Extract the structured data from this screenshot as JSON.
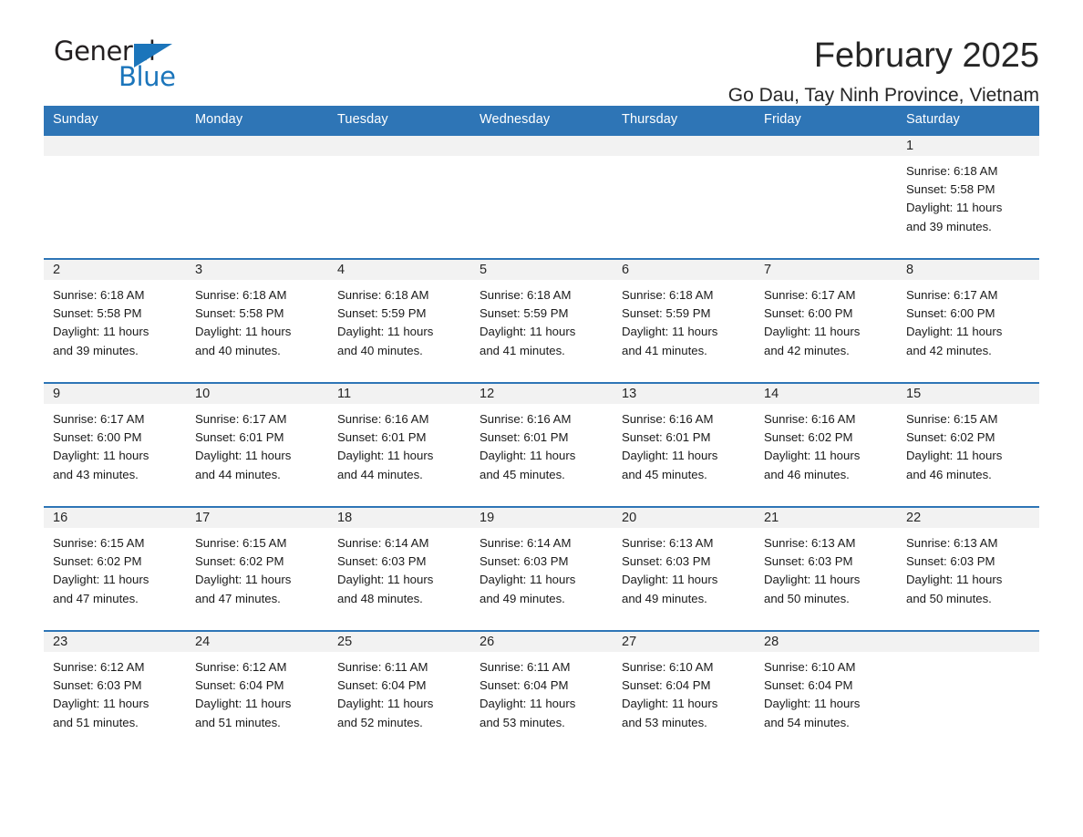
{
  "brand": {
    "name_top": "General",
    "name_bottom": "Blue",
    "accent_color": "#1b75bb",
    "triangle_icon": "brand-triangle-icon"
  },
  "header": {
    "title": "February 2025",
    "subtitle": "Go Dau, Tay Ninh Province, Vietnam"
  },
  "calendar": {
    "header_bg": "#2e75b6",
    "row_rule_color": "#2e75b6",
    "daynum_bg": "#f2f2f2",
    "weekday_headers": [
      "Sunday",
      "Monday",
      "Tuesday",
      "Wednesday",
      "Thursday",
      "Friday",
      "Saturday"
    ],
    "labels": {
      "sunrise": "Sunrise:",
      "sunset": "Sunset:",
      "daylight": "Daylight:"
    },
    "weeks": [
      [
        {
          "day": "",
          "sunrise": "",
          "sunset": "",
          "daylight": "",
          "daylight2": ""
        },
        {
          "day": "",
          "sunrise": "",
          "sunset": "",
          "daylight": "",
          "daylight2": ""
        },
        {
          "day": "",
          "sunrise": "",
          "sunset": "",
          "daylight": "",
          "daylight2": ""
        },
        {
          "day": "",
          "sunrise": "",
          "sunset": "",
          "daylight": "",
          "daylight2": ""
        },
        {
          "day": "",
          "sunrise": "",
          "sunset": "",
          "daylight": "",
          "daylight2": ""
        },
        {
          "day": "",
          "sunrise": "",
          "sunset": "",
          "daylight": "",
          "daylight2": ""
        },
        {
          "day": "1",
          "sunrise": "Sunrise: 6:18 AM",
          "sunset": "Sunset: 5:58 PM",
          "daylight": "Daylight: 11 hours",
          "daylight2": "and 39 minutes."
        }
      ],
      [
        {
          "day": "2",
          "sunrise": "Sunrise: 6:18 AM",
          "sunset": "Sunset: 5:58 PM",
          "daylight": "Daylight: 11 hours",
          "daylight2": "and 39 minutes."
        },
        {
          "day": "3",
          "sunrise": "Sunrise: 6:18 AM",
          "sunset": "Sunset: 5:58 PM",
          "daylight": "Daylight: 11 hours",
          "daylight2": "and 40 minutes."
        },
        {
          "day": "4",
          "sunrise": "Sunrise: 6:18 AM",
          "sunset": "Sunset: 5:59 PM",
          "daylight": "Daylight: 11 hours",
          "daylight2": "and 40 minutes."
        },
        {
          "day": "5",
          "sunrise": "Sunrise: 6:18 AM",
          "sunset": "Sunset: 5:59 PM",
          "daylight": "Daylight: 11 hours",
          "daylight2": "and 41 minutes."
        },
        {
          "day": "6",
          "sunrise": "Sunrise: 6:18 AM",
          "sunset": "Sunset: 5:59 PM",
          "daylight": "Daylight: 11 hours",
          "daylight2": "and 41 minutes."
        },
        {
          "day": "7",
          "sunrise": "Sunrise: 6:17 AM",
          "sunset": "Sunset: 6:00 PM",
          "daylight": "Daylight: 11 hours",
          "daylight2": "and 42 minutes."
        },
        {
          "day": "8",
          "sunrise": "Sunrise: 6:17 AM",
          "sunset": "Sunset: 6:00 PM",
          "daylight": "Daylight: 11 hours",
          "daylight2": "and 42 minutes."
        }
      ],
      [
        {
          "day": "9",
          "sunrise": "Sunrise: 6:17 AM",
          "sunset": "Sunset: 6:00 PM",
          "daylight": "Daylight: 11 hours",
          "daylight2": "and 43 minutes."
        },
        {
          "day": "10",
          "sunrise": "Sunrise: 6:17 AM",
          "sunset": "Sunset: 6:01 PM",
          "daylight": "Daylight: 11 hours",
          "daylight2": "and 44 minutes."
        },
        {
          "day": "11",
          "sunrise": "Sunrise: 6:16 AM",
          "sunset": "Sunset: 6:01 PM",
          "daylight": "Daylight: 11 hours",
          "daylight2": "and 44 minutes."
        },
        {
          "day": "12",
          "sunrise": "Sunrise: 6:16 AM",
          "sunset": "Sunset: 6:01 PM",
          "daylight": "Daylight: 11 hours",
          "daylight2": "and 45 minutes."
        },
        {
          "day": "13",
          "sunrise": "Sunrise: 6:16 AM",
          "sunset": "Sunset: 6:01 PM",
          "daylight": "Daylight: 11 hours",
          "daylight2": "and 45 minutes."
        },
        {
          "day": "14",
          "sunrise": "Sunrise: 6:16 AM",
          "sunset": "Sunset: 6:02 PM",
          "daylight": "Daylight: 11 hours",
          "daylight2": "and 46 minutes."
        },
        {
          "day": "15",
          "sunrise": "Sunrise: 6:15 AM",
          "sunset": "Sunset: 6:02 PM",
          "daylight": "Daylight: 11 hours",
          "daylight2": "and 46 minutes."
        }
      ],
      [
        {
          "day": "16",
          "sunrise": "Sunrise: 6:15 AM",
          "sunset": "Sunset: 6:02 PM",
          "daylight": "Daylight: 11 hours",
          "daylight2": "and 47 minutes."
        },
        {
          "day": "17",
          "sunrise": "Sunrise: 6:15 AM",
          "sunset": "Sunset: 6:02 PM",
          "daylight": "Daylight: 11 hours",
          "daylight2": "and 47 minutes."
        },
        {
          "day": "18",
          "sunrise": "Sunrise: 6:14 AM",
          "sunset": "Sunset: 6:03 PM",
          "daylight": "Daylight: 11 hours",
          "daylight2": "and 48 minutes."
        },
        {
          "day": "19",
          "sunrise": "Sunrise: 6:14 AM",
          "sunset": "Sunset: 6:03 PM",
          "daylight": "Daylight: 11 hours",
          "daylight2": "and 49 minutes."
        },
        {
          "day": "20",
          "sunrise": "Sunrise: 6:13 AM",
          "sunset": "Sunset: 6:03 PM",
          "daylight": "Daylight: 11 hours",
          "daylight2": "and 49 minutes."
        },
        {
          "day": "21",
          "sunrise": "Sunrise: 6:13 AM",
          "sunset": "Sunset: 6:03 PM",
          "daylight": "Daylight: 11 hours",
          "daylight2": "and 50 minutes."
        },
        {
          "day": "22",
          "sunrise": "Sunrise: 6:13 AM",
          "sunset": "Sunset: 6:03 PM",
          "daylight": "Daylight: 11 hours",
          "daylight2": "and 50 minutes."
        }
      ],
      [
        {
          "day": "23",
          "sunrise": "Sunrise: 6:12 AM",
          "sunset": "Sunset: 6:03 PM",
          "daylight": "Daylight: 11 hours",
          "daylight2": "and 51 minutes."
        },
        {
          "day": "24",
          "sunrise": "Sunrise: 6:12 AM",
          "sunset": "Sunset: 6:04 PM",
          "daylight": "Daylight: 11 hours",
          "daylight2": "and 51 minutes."
        },
        {
          "day": "25",
          "sunrise": "Sunrise: 6:11 AM",
          "sunset": "Sunset: 6:04 PM",
          "daylight": "Daylight: 11 hours",
          "daylight2": "and 52 minutes."
        },
        {
          "day": "26",
          "sunrise": "Sunrise: 6:11 AM",
          "sunset": "Sunset: 6:04 PM",
          "daylight": "Daylight: 11 hours",
          "daylight2": "and 53 minutes."
        },
        {
          "day": "27",
          "sunrise": "Sunrise: 6:10 AM",
          "sunset": "Sunset: 6:04 PM",
          "daylight": "Daylight: 11 hours",
          "daylight2": "and 53 minutes."
        },
        {
          "day": "28",
          "sunrise": "Sunrise: 6:10 AM",
          "sunset": "Sunset: 6:04 PM",
          "daylight": "Daylight: 11 hours",
          "daylight2": "and 54 minutes."
        },
        {
          "day": "",
          "sunrise": "",
          "sunset": "",
          "daylight": "",
          "daylight2": ""
        }
      ]
    ]
  }
}
